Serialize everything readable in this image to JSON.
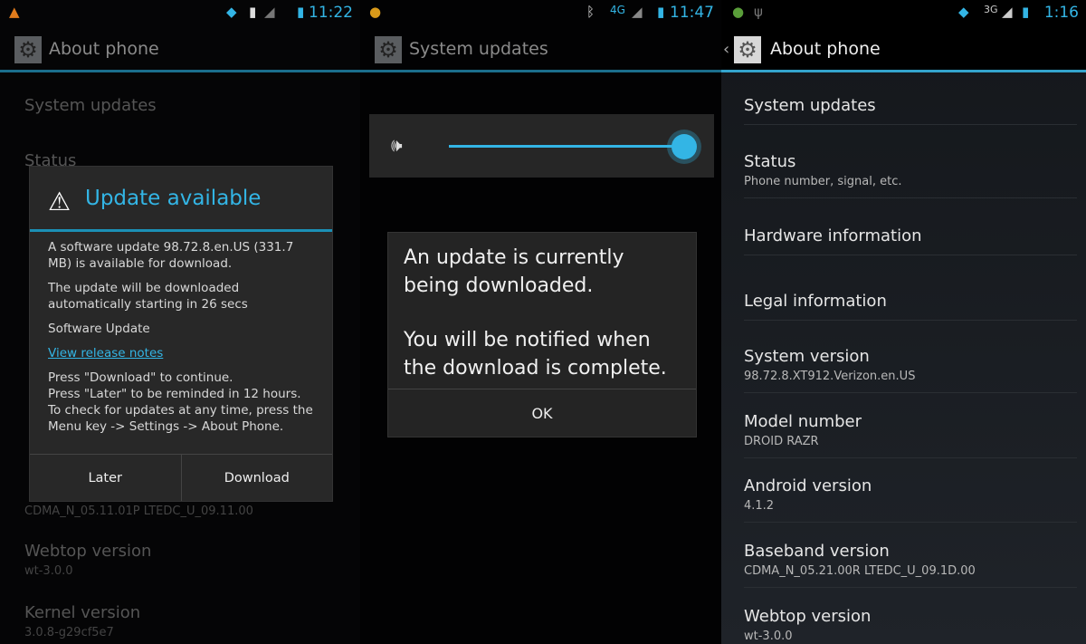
{
  "accent_color": "#33b5e5",
  "screens": [
    {
      "status": {
        "left_icons": [
          "warning-icon"
        ],
        "right_icons": [
          "wifi-icon",
          "sim-icon",
          "signal-icon",
          "battery-icon"
        ],
        "time": "11:22"
      },
      "action_bar": {
        "title": "About phone",
        "icon": "gear-icon"
      },
      "list": [
        {
          "title": "System updates"
        },
        {
          "title": "Status"
        },
        {
          "summary": "CDMA_N_05.11.01P LTEDC_U_09.11.00"
        },
        {
          "title": "Webtop version",
          "summary": "wt-3.0.0"
        },
        {
          "title": "Kernel version",
          "summary": "3.0.8-g29cf5e7"
        }
      ],
      "dialog": {
        "title": "Update available",
        "icon": "warning-icon",
        "paragraphs": [
          "A software update 98.72.8.en.US (331.7 MB) is available for download.",
          "The update will be downloaded automatically starting in 26 secs",
          "Software Update"
        ],
        "link": "View release notes",
        "instructions": [
          "Press \"Download\" to continue.",
          "Press \"Later\" to be reminded in 12 hours.",
          "To check for updates at any time, press the Menu key -> Settings -> About Phone."
        ],
        "buttons": {
          "later": "Later",
          "download": "Download"
        }
      }
    },
    {
      "status": {
        "left_icons": [
          "app-notification-icon"
        ],
        "right_icons": [
          "bluetooth-icon",
          "4g-lte-icon",
          "signal-icon",
          "battery-icon"
        ],
        "time": "11:47"
      },
      "action_bar": {
        "title": "System updates",
        "icon": "gear-icon"
      },
      "volume": {
        "icon": "ringer-volume-icon",
        "level_percent": 100
      },
      "dialog": {
        "message1": "An update is currently being downloaded.",
        "message2": "You will be notified when the download is complete.",
        "ok": "OK"
      }
    },
    {
      "status": {
        "left_icons": [
          "location-icon",
          "usb-icon"
        ],
        "right_icons": [
          "wifi-icon",
          "3g-icon",
          "signal-icon",
          "battery-icon"
        ],
        "time": "1:16"
      },
      "action_bar": {
        "title": "About phone",
        "icon": "gear-icon",
        "back": "‹"
      },
      "list": [
        {
          "title": "System updates"
        },
        {
          "title": "Status",
          "summary": "Phone number, signal, etc."
        },
        {
          "title": "Hardware information"
        },
        {
          "title": "Legal information"
        },
        {
          "title": "System version",
          "summary": "98.72.8.XT912.Verizon.en.US"
        },
        {
          "title": "Model number",
          "summary": "DROID RAZR"
        },
        {
          "title": "Android version",
          "summary": "4.1.2"
        },
        {
          "title": "Baseband version",
          "summary": "CDMA_N_05.21.00R LTEDC_U_09.1D.00"
        },
        {
          "title": "Webtop version",
          "summary": "wt-3.0.0"
        }
      ]
    }
  ]
}
